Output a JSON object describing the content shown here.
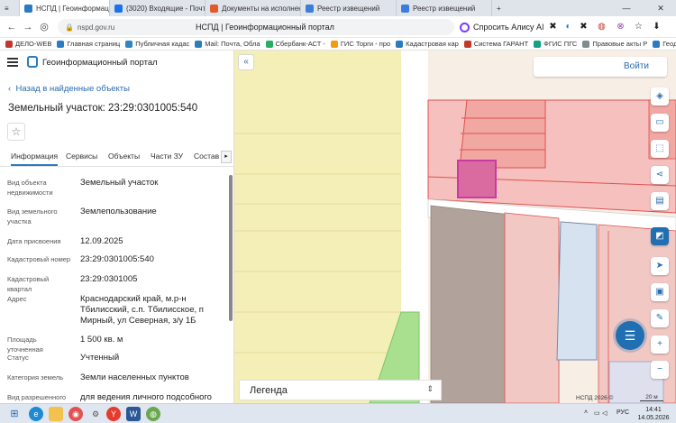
{
  "browser": {
    "tabs": [
      {
        "label": "НСПД | Геоинформацио",
        "active": true,
        "color": "#2b7bc0"
      },
      {
        "label": "(3020) Входящие - Почта",
        "active": false,
        "color": "#1a73e8"
      },
      {
        "label": "Документы на исполнени",
        "active": false,
        "color": "#e05a2b"
      },
      {
        "label": "Реестр извещений",
        "active": false,
        "color": "#3b7ddd"
      },
      {
        "label": "Реестр извещений",
        "active": false,
        "color": "#3b7ddd"
      }
    ],
    "close_glyph": "✕",
    "new_tab_glyph": "+",
    "url": "nspd.gov.ru",
    "page_title": "НСПД | Геоинформационный портал",
    "alice_label": "Спросить Алису AI",
    "bookmarks": [
      {
        "label": "ДЕЛО-WEB",
        "color": "#c0392b"
      },
      {
        "label": "Главная страниц",
        "color": "#2b7bc0"
      },
      {
        "label": "Публичная кадас",
        "color": "#2e86c1"
      },
      {
        "label": "Mail: Почта, Обла",
        "color": "#2980b9"
      },
      {
        "label": "Сбербанк-АСТ -",
        "color": "#27ae60"
      },
      {
        "label": "ГИС Торги - про",
        "color": "#f39c12"
      },
      {
        "label": "Кадастровая кар",
        "color": "#2b7bc0"
      },
      {
        "label": "Система ГАРАНТ",
        "color": "#c0392b"
      },
      {
        "label": "ФГИС ПГС",
        "color": "#16a085"
      },
      {
        "label": "Правовые акты Р",
        "color": "#7f8c8d"
      },
      {
        "label": "Геодезичен",
        "color": "#2b7bc0"
      }
    ]
  },
  "panel": {
    "portal_title": "Геоинформационный портал",
    "back_label": "Назад в найденные объекты",
    "object_title": "Земельный участок: 23:29:0301005:540",
    "tabs": [
      "Информация",
      "Сервисы",
      "Объекты",
      "Части ЗУ",
      "Состав"
    ],
    "active_tab": "Информация",
    "fields": [
      {
        "key": "Вид объекта недвижимости",
        "value": "Земельный участок"
      },
      {
        "key": "Вид земельного участка",
        "value": "Землепользование"
      },
      {
        "key": "Дата присвоения",
        "value": "12.09.2025"
      },
      {
        "key": "Кадастровый номер",
        "value": "23:29:0301005:540"
      },
      {
        "key": "Кадастровый квартал",
        "value": "23:29:0301005"
      },
      {
        "key": "Адрес",
        "value": "Краснодарский край, м.р-н Тбилисский, с.п. Тбилисское, п Мирный, ул Северная, з/у 1Б"
      },
      {
        "key": "Площадь уточненная",
        "value": "1 500 кв. м"
      },
      {
        "key": "Статус",
        "value": "Учтенный"
      },
      {
        "key": "Категория земель",
        "value": "Земли населенных пунктов"
      },
      {
        "key": "Вид разрешенного",
        "value": "для ведения личного подсобного"
      }
    ]
  },
  "map": {
    "login_label": "Войти",
    "legend_label": "Легенда",
    "attribution": "НСПД 2026 ©",
    "scale_label": "20 м",
    "colors": {
      "highlight": "#c93aa3",
      "parcel_red": "#e0524f",
      "yellow_zone": "#f3efb6",
      "green_zone": "#a9e08f"
    }
  },
  "taskbar": {
    "language": "РУС",
    "time": "14:41",
    "date": "14.05.2026"
  }
}
